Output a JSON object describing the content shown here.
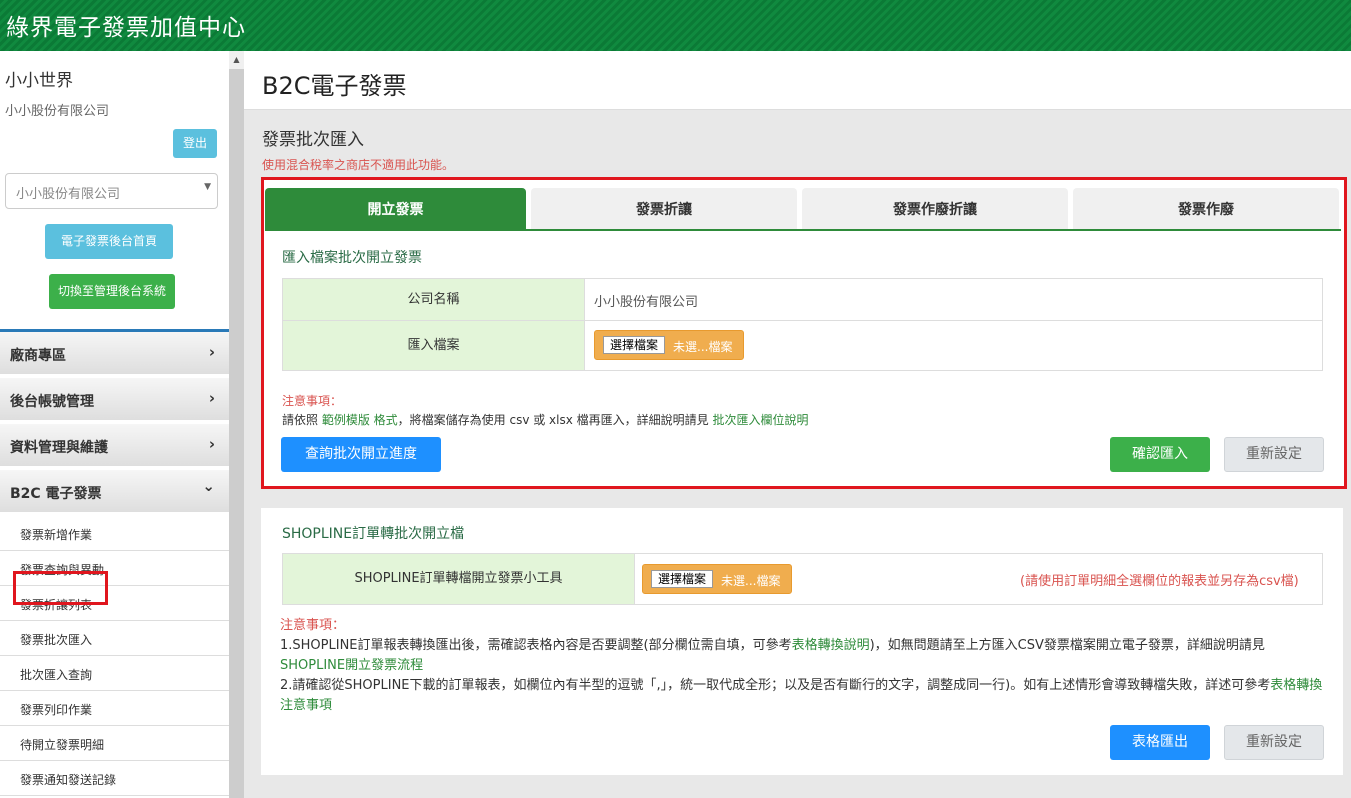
{
  "app": {
    "title": "綠界電子發票加值中心"
  },
  "user": {
    "name": "小小世界",
    "company": "小小股份有限公司",
    "logout_label": "登出",
    "company_select_value": "小小股份有限公司",
    "home_button": "電子發票後台首頁",
    "switch_button": "切換至管理後台系統"
  },
  "nav": {
    "items": [
      {
        "label": "廠商專區",
        "chevron": "›"
      },
      {
        "label": "後台帳號管理",
        "chevron": "›"
      },
      {
        "label": "資料管理與維護",
        "chevron": "›"
      },
      {
        "label": "B2C 電子發票",
        "chevron": "⌄"
      }
    ],
    "subitems": [
      {
        "label": "發票新增作業"
      },
      {
        "label": "發票查詢與異動"
      },
      {
        "label": "發票折讓列表"
      },
      {
        "label": "發票批次匯入"
      },
      {
        "label": "批次匯入查詢"
      },
      {
        "label": "發票列印作業"
      },
      {
        "label": "待開立發票明細"
      },
      {
        "label": "發票通知發送記錄"
      }
    ]
  },
  "header": {
    "title": "B2C電子發票"
  },
  "section": {
    "title": "發票批次匯入",
    "warning": "使用混合稅率之商店不適用此功能。"
  },
  "tabs": [
    {
      "label": "開立發票",
      "active": true
    },
    {
      "label": "發票折讓",
      "active": false
    },
    {
      "label": "發票作廢折讓",
      "active": false
    },
    {
      "label": "發票作廢",
      "active": false
    }
  ],
  "import_form": {
    "subtitle": "匯入檔案批次開立發票",
    "company_label": "公司名稱",
    "company_value": "小小股份有限公司",
    "file_label": "匯入檔案",
    "file_button": "選擇檔案",
    "file_none": "未選...檔案",
    "notice_title": "注意事項：",
    "notice_prefix": "請依照 ",
    "notice_link1": "範例模版 格式",
    "notice_mid": "，將檔案儲存為使用 csv 或 xlsx 檔再匯入，詳細說明請見 ",
    "notice_link2": "批次匯入欄位說明",
    "progress_button": "查詢批次開立進度",
    "confirm_button": "確認匯入",
    "reset_button": "重新設定"
  },
  "shopline": {
    "title": "SHOPLINE訂單轉批次開立檔",
    "tool_label": "SHOPLINE訂單轉檔開立發票小工具",
    "file_button": "選擇檔案",
    "file_none": "未選...檔案",
    "hint": "(請使用訂單明細全選欄位的報表並另存為csv檔)",
    "notice_title": "注意事項：",
    "notice1_a": "1.SHOPLINE訂單報表轉換匯出後，需確認表格內容是否要調整(部分欄位需自填，可參考",
    "notice1_link": "表格轉換說明",
    "notice1_b": ")，如無問題請至上方匯入CSV發票檔案開立電子發票，詳細說明請見",
    "notice1_link2": "SHOPLINE開立發票流程",
    "notice2_a": "2.請確認從SHOPLINE下載的訂單報表，如欄位內有半型的逗號「,」，統一取代成全形；以及是否有斷行的文字，調整成同一行)。如有上述情形會導致轉檔失敗，詳述可參考",
    "notice2_link": "表格轉換注意事項",
    "export_button": "表格匯出",
    "reset_button": "重新設定"
  },
  "colors": {
    "brand_green": "#108a3f",
    "tab_active": "#2e8b3a",
    "highlight_red": "#e0161e",
    "button_blue": "#1e90ff",
    "button_green": "#3cb04a",
    "file_orange": "#f0ad4e"
  },
  "icons": {
    "chevron_right": "chevron-right-icon",
    "chevron_down": "chevron-down-icon",
    "select_caret": "caret-down-icon",
    "scroll_up": "scroll-up-arrow-icon"
  }
}
